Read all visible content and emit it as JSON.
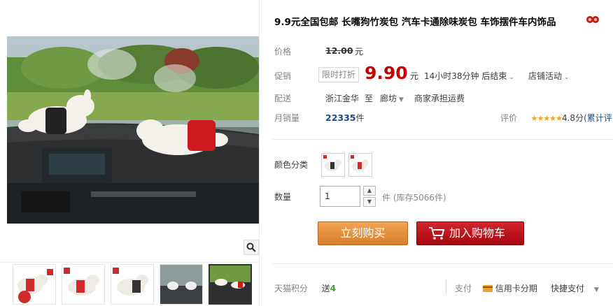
{
  "product": {
    "title": "9.9元全国包邮 长嘴狗竹炭包 汽车卡通除味炭包 车饰摆件车内饰品"
  },
  "price": {
    "label": "价格",
    "original": "12.00",
    "unit": "元"
  },
  "promo": {
    "label": "促销",
    "tag": "限时打折",
    "price": "9.90",
    "unit": "元",
    "timer": "14小时38分钟 后结束",
    "shop_activity": "店铺活动"
  },
  "shipping": {
    "label": "配送",
    "from": "浙江金华",
    "to_word": "至",
    "to": "廊坊",
    "fee": "商家承担运费"
  },
  "sales": {
    "label": "月销量",
    "count": "22335",
    "unit": "件",
    "rating_label": "评价",
    "stars": "★★★★★",
    "score": "4.8分",
    "reviews_link": "(累计评"
  },
  "sku": {
    "color_label": "颜色分类",
    "qty_label": "数量",
    "qty_value": "1",
    "qty_unit_stock": "件 (库存5066件)"
  },
  "actions": {
    "buy_now": "立刻购买",
    "add_to_cart": "加入购物车"
  },
  "bottom": {
    "points_label": "天猫积分",
    "points_prefix": "送",
    "points_value": "4",
    "pay_label": "支付",
    "credit_installment": "信用卡分期",
    "quick_pay": "快捷支付"
  },
  "colors": {
    "price_red": "#c40000",
    "link_blue": "#1a4b8c",
    "buy_orange": "#e28d3c",
    "cart_red": "#b90f16",
    "star_gold": "#f7a31c"
  }
}
